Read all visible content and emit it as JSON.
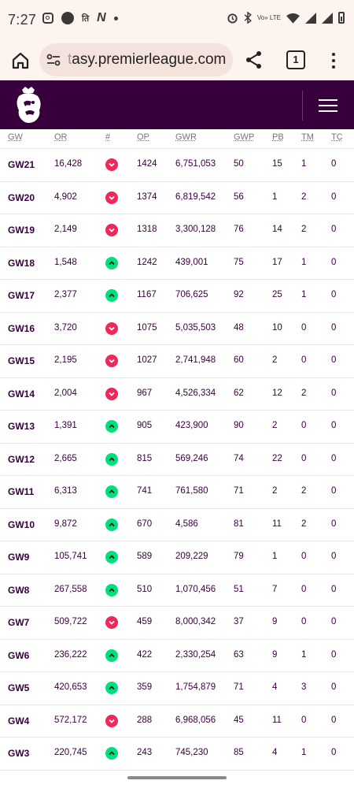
{
  "status": {
    "time": "7:27",
    "carrier_text": "Vo» LTE",
    "small_text": "ति"
  },
  "browser": {
    "url_prefix": "t",
    "url_main": "asy.premierleague.com",
    "tab_count": "1"
  },
  "table": {
    "headers": [
      "GW",
      "OR",
      "#",
      "OP",
      "GWR",
      "GWP",
      "PB",
      "TM",
      "TC"
    ],
    "rows": [
      {
        "gw": "GW21",
        "or": "16,428",
        "trend": "down",
        "op": "1424",
        "gwr": "6,751,053",
        "gwp": "50",
        "pb": "15",
        "tm": "1",
        "tc": "0"
      },
      {
        "gw": "GW20",
        "or": "4,902",
        "trend": "down",
        "op": "1374",
        "gwr": "6,819,542",
        "gwp": "56",
        "pb": "1",
        "tm": "2",
        "tc": "0"
      },
      {
        "gw": "GW19",
        "or": "2,149",
        "trend": "down",
        "op": "1318",
        "gwr": "3,300,128",
        "gwp": "76",
        "pb": "14",
        "tm": "2",
        "tc": "0"
      },
      {
        "gw": "GW18",
        "or": "1,548",
        "trend": "up",
        "op": "1242",
        "gwr": "439,001",
        "gwp": "75",
        "pb": "17",
        "tm": "1",
        "tc": "0"
      },
      {
        "gw": "GW17",
        "or": "2,377",
        "trend": "up",
        "op": "1167",
        "gwr": "706,625",
        "gwp": "92",
        "pb": "25",
        "tm": "1",
        "tc": "0"
      },
      {
        "gw": "GW16",
        "or": "3,720",
        "trend": "down",
        "op": "1075",
        "gwr": "5,035,503",
        "gwp": "48",
        "pb": "10",
        "tm": "0",
        "tc": "0"
      },
      {
        "gw": "GW15",
        "or": "2,195",
        "trend": "down",
        "op": "1027",
        "gwr": "2,741,948",
        "gwp": "60",
        "pb": "2",
        "tm": "0",
        "tc": "0"
      },
      {
        "gw": "GW14",
        "or": "2,004",
        "trend": "down",
        "op": "967",
        "gwr": "4,526,334",
        "gwp": "62",
        "pb": "12",
        "tm": "2",
        "tc": "0"
      },
      {
        "gw": "GW13",
        "or": "1,391",
        "trend": "up",
        "op": "905",
        "gwr": "423,900",
        "gwp": "90",
        "pb": "2",
        "tm": "0",
        "tc": "0"
      },
      {
        "gw": "GW12",
        "or": "2,665",
        "trend": "up",
        "op": "815",
        "gwr": "569,246",
        "gwp": "74",
        "pb": "22",
        "tm": "0",
        "tc": "0"
      },
      {
        "gw": "GW11",
        "or": "6,313",
        "trend": "up",
        "op": "741",
        "gwr": "761,580",
        "gwp": "71",
        "pb": "2",
        "tm": "2",
        "tc": "0"
      },
      {
        "gw": "GW10",
        "or": "9,872",
        "trend": "up",
        "op": "670",
        "gwr": "4,586",
        "gwp": "81",
        "pb": "11",
        "tm": "2",
        "tc": "0"
      },
      {
        "gw": "GW9",
        "or": "105,741",
        "trend": "up",
        "op": "589",
        "gwr": "209,229",
        "gwp": "79",
        "pb": "1",
        "tm": "0",
        "tc": "0"
      },
      {
        "gw": "GW8",
        "or": "267,558",
        "trend": "up",
        "op": "510",
        "gwr": "1,070,456",
        "gwp": "51",
        "pb": "7",
        "tm": "0",
        "tc": "0"
      },
      {
        "gw": "GW7",
        "or": "509,722",
        "trend": "down",
        "op": "459",
        "gwr": "8,000,342",
        "gwp": "37",
        "pb": "9",
        "tm": "0",
        "tc": "0"
      },
      {
        "gw": "GW6",
        "or": "236,222",
        "trend": "up",
        "op": "422",
        "gwr": "2,330,254",
        "gwp": "63",
        "pb": "9",
        "tm": "1",
        "tc": "0"
      },
      {
        "gw": "GW5",
        "or": "420,653",
        "trend": "up",
        "op": "359",
        "gwr": "1,754,879",
        "gwp": "71",
        "pb": "4",
        "tm": "3",
        "tc": "0"
      },
      {
        "gw": "GW4",
        "or": "572,172",
        "trend": "down",
        "op": "288",
        "gwr": "6,968,056",
        "gwp": "45",
        "pb": "11",
        "tm": "0",
        "tc": "0"
      },
      {
        "gw": "GW3",
        "or": "220,745",
        "trend": "up",
        "op": "243",
        "gwr": "745,230",
        "gwp": "85",
        "pb": "4",
        "tm": "1",
        "tc": "0"
      }
    ]
  },
  "icons": {
    "trend_down": "chevron-down-icon",
    "trend_up": "chevron-up-icon"
  },
  "colors": {
    "brand_purple": "#37003c",
    "down": "#f0285a",
    "up": "#00e07d"
  }
}
